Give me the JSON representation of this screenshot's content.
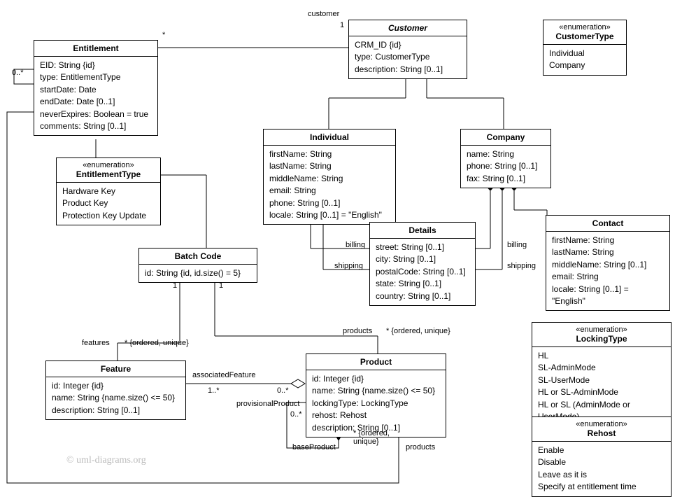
{
  "classes": {
    "entitlement": {
      "name": "Entitlement",
      "attrs": [
        "EID: String {id}",
        "type: EntitlementType",
        "startDate: Date",
        "endDate: Date [0..1]",
        "neverExpires: Boolean = true",
        "comments: String [0..1]"
      ]
    },
    "customer": {
      "name": "Customer",
      "attrs": [
        "CRM_ID {id}",
        "type: CustomerType",
        "description: String [0..1]"
      ]
    },
    "customerType": {
      "stereo": "«enumeration»",
      "name": "CustomerType",
      "attrs": [
        "Individual",
        "Company"
      ]
    },
    "entitlementType": {
      "stereo": "«enumeration»",
      "name": "EntitlementType",
      "attrs": [
        "Hardware Key",
        "Product Key",
        "Protection Key Update"
      ]
    },
    "individual": {
      "name": "Individual",
      "attrs": [
        "firstName: String",
        "lastName: String",
        "middleName: String",
        "email: String",
        "phone: String [0..1]",
        "locale: String [0..1] = \"English\""
      ]
    },
    "company": {
      "name": "Company",
      "attrs": [
        "name: String",
        "phone: String [0..1]",
        "fax: String [0..1]"
      ]
    },
    "details": {
      "name": "Details",
      "attrs": [
        "street: String [0..1]",
        "city: String [0..1]",
        "postalCode: String [0..1]",
        "state: String [0..1]",
        "country: String [0..1]"
      ]
    },
    "contact": {
      "name": "Contact",
      "attrs": [
        "firstName: String",
        "lastName: String",
        "middleName: String [0..1]",
        "email: String",
        "locale: String [0..1] = \"English\""
      ]
    },
    "batchCode": {
      "name": "Batch Code",
      "attrs": [
        "id: String {id, id.size() = 5}"
      ]
    },
    "feature": {
      "name": "Feature",
      "attrs": [
        "id: Integer {id}",
        "name: String {name.size() <= 50}",
        "description: String [0..1]"
      ]
    },
    "product": {
      "name": "Product",
      "attrs": [
        "id: Integer {id}",
        "name: String {name.size() <= 50}",
        "lockingType: LockingType",
        "rehost: Rehost",
        "description: String [0..1]"
      ]
    },
    "lockingType": {
      "stereo": "«enumeration»",
      "name": "LockingType",
      "attrs": [
        "HL",
        "SL-AdminMode",
        "SL-UserMode",
        "HL or SL-AdminMode",
        "HL or SL (AdminMode or UserMode)"
      ]
    },
    "rehost": {
      "stereo": "«enumeration»",
      "name": "Rehost",
      "attrs": [
        "Enable",
        "Disable",
        "Leave as it is",
        "Specify at entitlement time"
      ]
    }
  },
  "labels": {
    "customerRole": "customer",
    "one1": "1",
    "one2": "1",
    "one3": "1",
    "star1": "*",
    "zeroStar1": "0..*",
    "billing1": "billing",
    "shipping1": "shipping",
    "billing2": "billing",
    "shipping2": "shipping",
    "featuresRole": "features",
    "orderedUnique1": "* {ordered, unique}",
    "productsRole1": "products",
    "orderedUnique2": "* {ordered, unique}",
    "associatedFeature": "associatedFeature",
    "oneStar": "1..*",
    "zeroStarP": "0..*",
    "provisionalProduct": "provisionalProduct",
    "zeroStarPP": "0..*",
    "baseProduct": "baseProduct",
    "orderedUnique3": "* {ordered,\nunique}",
    "productsRole2": "products"
  },
  "watermark": "© uml-diagrams.org"
}
